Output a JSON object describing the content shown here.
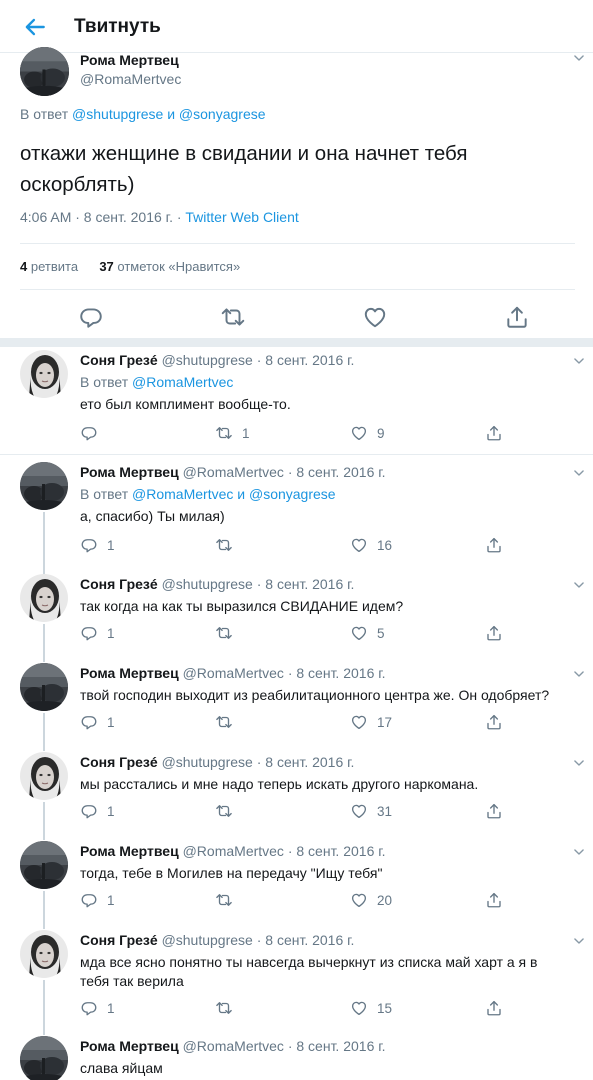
{
  "header": {
    "title": "Твитнуть"
  },
  "main_tweet": {
    "name": "Рома Мертвец",
    "handle": "@RomaMertvec",
    "reply_prefix": "В ответ",
    "reply_user1": "@shutupgrese",
    "reply_and": "и",
    "reply_user2": "@sonyagrese",
    "text": "откажи женщине в свидании и она начнет тебя оскорблять)",
    "time": "4:06 AM · 8 сент. 2016 г. · ",
    "client": "Twitter Web Client",
    "retweets_count": "4",
    "retweets_label": "ретвита",
    "likes_count": "37",
    "likes_label": "отметок «Нравится»"
  },
  "replies": [
    {
      "name": "Соня Грезé",
      "handle": "@shutupgrese · 8 сент. 2016 г.",
      "reply_prefix": "В ответ",
      "reply_to": "@RomaMertvec",
      "text": "ето был комплимент вообще-то.",
      "replies": "",
      "retweets": "1",
      "likes": "9"
    },
    {
      "name": "Рома Мертвец",
      "handle": "@RomaMertvec · 8 сент. 2016 г.",
      "reply_prefix": "В ответ",
      "reply_to": "@RomaMertvec",
      "reply_and": "и",
      "reply_to2": "@sonyagrese",
      "text": "а, спасибо) Ты милая)",
      "replies": "1",
      "retweets": "",
      "likes": "16"
    },
    {
      "name": "Соня Грезé",
      "handle": "@shutupgrese · 8 сент. 2016 г.",
      "text": "так когда на как ты выразился СВИДАНИЕ идем?",
      "replies": "1",
      "retweets": "",
      "likes": "5"
    },
    {
      "name": "Рома Мертвец",
      "handle": "@RomaMertvec · 8 сент. 2016 г.",
      "text": "твой господин выходит из реабилитационного центра же. Он одобряет?",
      "replies": "1",
      "retweets": "",
      "likes": "17"
    },
    {
      "name": "Соня Грезé",
      "handle": "@shutupgrese · 8 сент. 2016 г.",
      "text": "мы расстались и мне надо теперь искать другого наркомана.",
      "replies": "1",
      "retweets": "",
      "likes": "31"
    },
    {
      "name": "Рома Мертвец",
      "handle": "@RomaMertvec · 8 сент. 2016 г.",
      "text": "тогда, тебе в Могилев на передачу \"Ищу тебя\"",
      "replies": "1",
      "retweets": "",
      "likes": "20"
    },
    {
      "name": "Соня Грезé",
      "handle": "@shutupgrese · 8 сент. 2016 г.",
      "text_line1": "мда все ясно понятно ты навсегда вычеркнут из списка май харт а я в",
      "text_line2": "тебя так верила",
      "replies": "1",
      "retweets": "",
      "likes": "15"
    },
    {
      "name": "Рома Мертвец",
      "handle": "@RomaMertvec · 8 сент. 2016 г.",
      "text": "слава яйцам"
    }
  ]
}
